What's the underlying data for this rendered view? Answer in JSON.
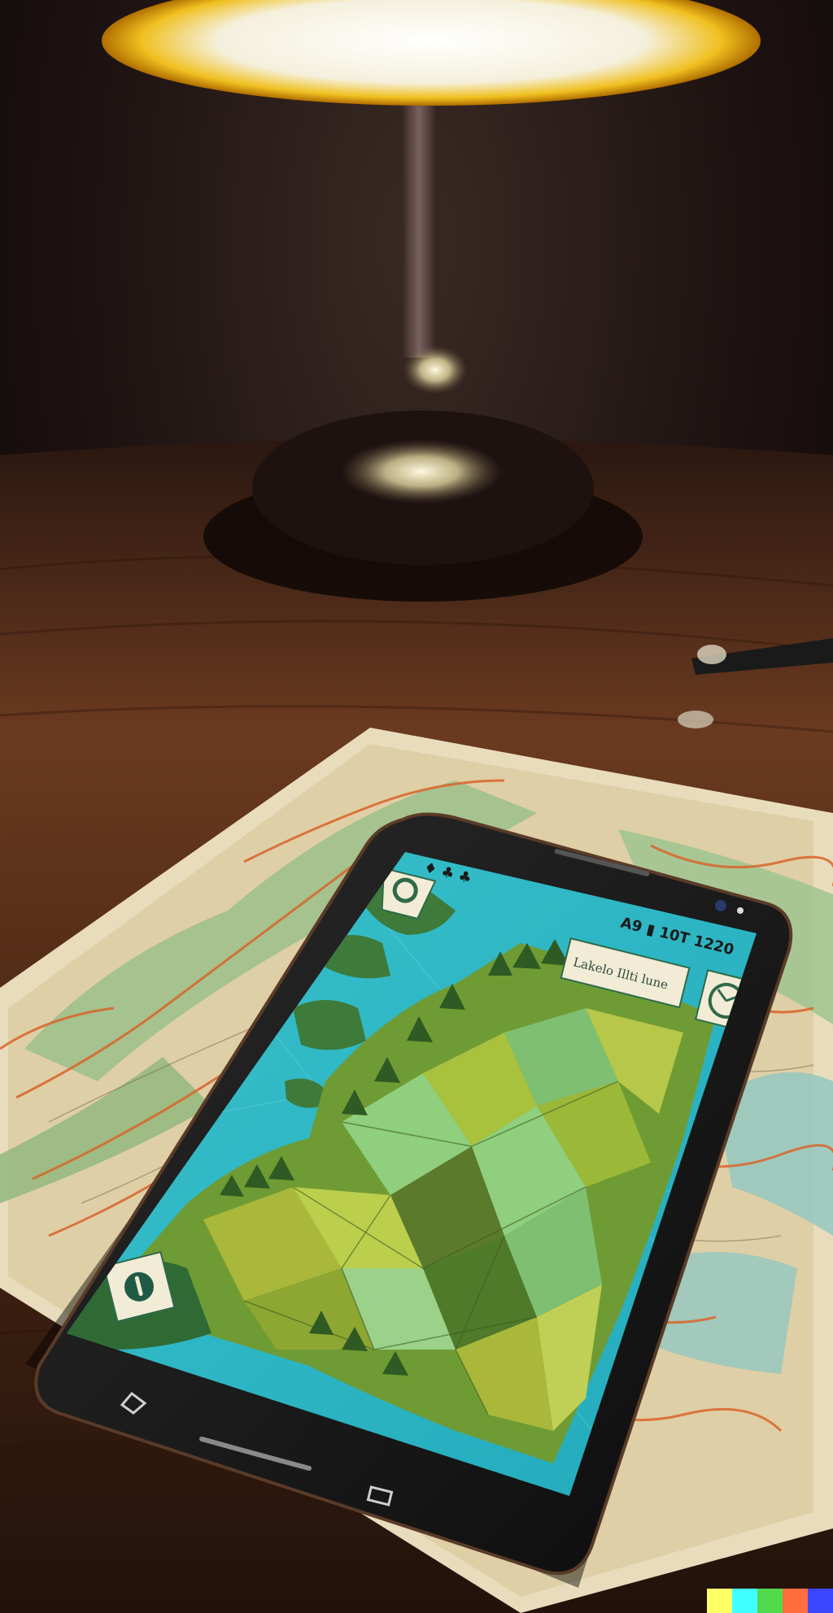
{
  "phone": {
    "status_left": "♦ ♣ ♣",
    "status_right": "A9 ▮ 10T 1220",
    "map_label": "Lakelo Illti lune"
  },
  "palette": {
    "water": "#2fb7c4",
    "land_light": "#8fcf7e",
    "land_olive": "#a9b83a",
    "land_dark": "#5c7a2c",
    "lamp_glow": "#fff6c8",
    "lamp_rim": "#e8a800",
    "desk_wood": "#5a2f18",
    "paper": "#e8dcbc"
  },
  "watermark": {
    "colors": [
      "#ffff66",
      "#42ffff",
      "#51da4c",
      "#ff6e3c",
      "#3c46ff"
    ]
  }
}
